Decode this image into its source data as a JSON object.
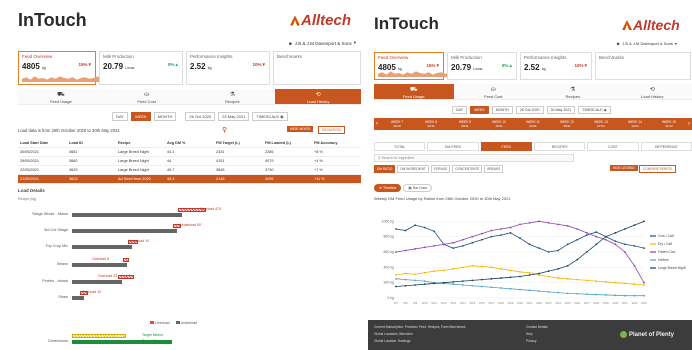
{
  "left": {
    "brand": "InTouch",
    "logo": "Alltech",
    "user": "J.B & J.M Davenport & Sons",
    "kpis": [
      {
        "label": "Feed Overview",
        "value": "4805",
        "unit": "kg",
        "pct": "15%",
        "trend": "down",
        "active": true
      },
      {
        "label": "Milk Production",
        "value": "20.79",
        "unit": "L/cow",
        "pct": "8%",
        "trend": "up",
        "active": false
      },
      {
        "label": "Performance Insights",
        "value": "2.52",
        "unit": "kg",
        "pct": "10%",
        "trend": "down",
        "active": false
      },
      {
        "label": "Benchmarks",
        "value": "",
        "unit": "",
        "pct": "",
        "trend": "",
        "active": false
      }
    ],
    "tabs": [
      "Feed Usage",
      "Feed Cost",
      "Recipes",
      "Load History"
    ],
    "range_buttons": [
      "DAY",
      "WEEK",
      "MONTH"
    ],
    "date_from": "26 Oct 2020",
    "date_to": "23 May 2021",
    "timescale": "TIMESCALE",
    "load_note": "Load data is from 26th October 2020 to 30th May 2021",
    "btn_hide": "HIDE MIXER",
    "btn_deviation": "DEVIATION",
    "table_headers": [
      "Load Start Date",
      "Load ID",
      "Recipe",
      "Avg DM %",
      "FM Target (L)",
      "FM Loaded (L)",
      "FM Accuracy"
    ],
    "rows": [
      [
        "30/05/2021",
        "3681",
        "Large Breed Night",
        "44.1",
        "2331",
        "2286",
        "+8 %"
      ],
      [
        "29/05/2021",
        "3680",
        "Large Breed Night",
        "44",
        "4151",
        "4079",
        "+4 %"
      ],
      [
        "22/05/2021",
        "3629",
        "Large Breed Night",
        "45.7",
        "3848",
        "3730",
        "+7 %"
      ],
      [
        "21/05/2021",
        "3623",
        "Ad Seed from 2020",
        "45.3",
        "2148",
        "2095",
        "+11 %"
      ]
    ],
    "details_title": "Load Details",
    "details_sub": "Recipe (kg)",
    "bar_labels": [
      "Silage Whole - Maize",
      "3rd Cut Silage",
      "Top Crop Mix",
      "Beans",
      "Protein - bicarb",
      "Straw"
    ],
    "bar_notes": [
      "Overload 470",
      "Underload 50",
      "Underload 10",
      "Overload 8",
      "Overload 23",
      "Overload 10"
    ],
    "legend": [
      "Overload",
      "Underload"
    ],
    "bottom_label": "Dimensions",
    "bottom_notes": [
      "Target Mixers",
      "Target Mixers"
    ]
  },
  "right": {
    "brand": "InTouch",
    "logo": "Alltech",
    "user": "J.B & J.M Davenport & Sons",
    "kpis": [
      {
        "label": "Feed Overview",
        "value": "4805",
        "unit": "kg",
        "pct": "15%",
        "trend": "down",
        "active": true
      },
      {
        "label": "Milk Production",
        "value": "20.79",
        "unit": "L/cow",
        "pct": "8%",
        "trend": "up",
        "active": false
      },
      {
        "label": "Performance Insights",
        "value": "2.52",
        "unit": "kg",
        "pct": "10%",
        "trend": "down",
        "active": false
      },
      {
        "label": "Benchmarks",
        "value": "",
        "unit": "",
        "pct": "",
        "trend": "",
        "active": false
      }
    ],
    "tabs": [
      "Feed Usage",
      "Feed Cost",
      "Recipes",
      "Load History"
    ],
    "range_buttons": [
      "DAY",
      "WEEK",
      "MONTH"
    ],
    "date_from": "26 Oct 2020",
    "date_to": "30 May 2021",
    "timescale": "TIMESCALE",
    "weeks": [
      {
        "w": "WEEK 7",
        "d": "26/10"
      },
      {
        "w": "WEEK 8",
        "d": "02/11"
      },
      {
        "w": "WEEK 9",
        "d": "09/11"
      },
      {
        "w": "WEEK 10",
        "d": "16/11"
      },
      {
        "w": "WEEK 11",
        "d": "23/11"
      },
      {
        "w": "WEEK 12",
        "d": "30/11"
      },
      {
        "w": "WEEK 13",
        "d": "07/12"
      },
      {
        "w": "WEEK 14",
        "d": "14/12"
      },
      {
        "w": "WEEK 15",
        "d": "21/12"
      }
    ],
    "subtabs": [
      "TOTAL",
      "DM FEED",
      "FEED",
      "RECIPES",
      "COST",
      "DIFFERENCE"
    ],
    "filter_placeholder": "Search for Ingredient",
    "pills": [
      "DM RATIO",
      "DM INGREDIENT",
      "FORAGE",
      "CONCENTRATE",
      "BREAKS"
    ],
    "btn_hide": "HIDE LEGEND",
    "btn_compare": "COMPARE PERIOD",
    "graph_tabs": [
      "Timeline",
      "Bar Data"
    ],
    "chart_title": "Weekly DM Feed Usage by Ration from 26th October 2020 to 30th May 2021",
    "footer": {
      "lines": [
        "Current Subscription: Precision Feed, Recipes, Farm Benchmark",
        "Global Locations: Blenheim",
        "Global Location: Hastings"
      ],
      "col2": [
        "Contact Details",
        "Help",
        "Privacy"
      ],
      "pop": "Planet of Plenty"
    }
  },
  "chart_data": {
    "type": "line",
    "title": "Weekly DM Feed Usage by Ration from 26th October 2020 to 30th May 2021",
    "x": [
      "W7",
      "W8",
      "W9",
      "W10",
      "W11",
      "W12",
      "W13",
      "W14",
      "W15",
      "W16",
      "W17",
      "W18",
      "W19",
      "W20",
      "W21",
      "W22",
      "W23",
      "W24",
      "W25",
      "W26",
      "W27",
      "W28",
      "W29",
      "W30",
      "W31",
      "W32",
      "W33"
    ],
    "ylim": [
      0,
      1200
    ],
    "yticks": [
      "0 kg",
      "200 kg",
      "400 kg",
      "600 kg",
      "800 kg",
      "1000 kg"
    ],
    "series": [
      {
        "name": "Cow / Calf",
        "color": "#1f4e79",
        "values": [
          900,
          880,
          950,
          920,
          870,
          700,
          650,
          680,
          720,
          760,
          800,
          820,
          850,
          780,
          700,
          650,
          600,
          620,
          700,
          760,
          820,
          860,
          800,
          740,
          700,
          680,
          650
        ]
      },
      {
        "name": "Dry / Calf",
        "color": "#f4b400",
        "values": [
          300,
          320,
          310,
          330,
          350,
          360,
          380,
          400,
          420,
          410,
          400,
          380,
          360,
          340,
          330,
          300,
          280,
          260,
          250,
          240,
          230,
          220,
          210,
          200,
          190,
          180,
          170
        ]
      },
      {
        "name": "Fatten Cow",
        "color": "#8e44ad",
        "values": [
          600,
          620,
          640,
          660,
          680,
          700,
          720,
          760,
          800,
          840,
          880,
          900,
          920,
          960,
          980,
          1000,
          980,
          960,
          940,
          900,
          850,
          800,
          760,
          700,
          600,
          420,
          200
        ]
      },
      {
        "name": "Heifers",
        "color": "#4fa3c7",
        "values": [
          250,
          240,
          230,
          220,
          200,
          190,
          180,
          170,
          160,
          150,
          140,
          130,
          120,
          110,
          100,
          90,
          80,
          70,
          60,
          55,
          50,
          45,
          40,
          35,
          30,
          30,
          30
        ]
      },
      {
        "name": "Large Breed Night",
        "color": "#154360",
        "values": [
          150,
          160,
          170,
          180,
          190,
          200,
          210,
          220,
          230,
          240,
          250,
          260,
          270,
          280,
          300,
          320,
          350,
          380,
          420,
          500,
          600,
          700,
          800,
          850,
          900,
          950,
          1000
        ]
      }
    ]
  }
}
